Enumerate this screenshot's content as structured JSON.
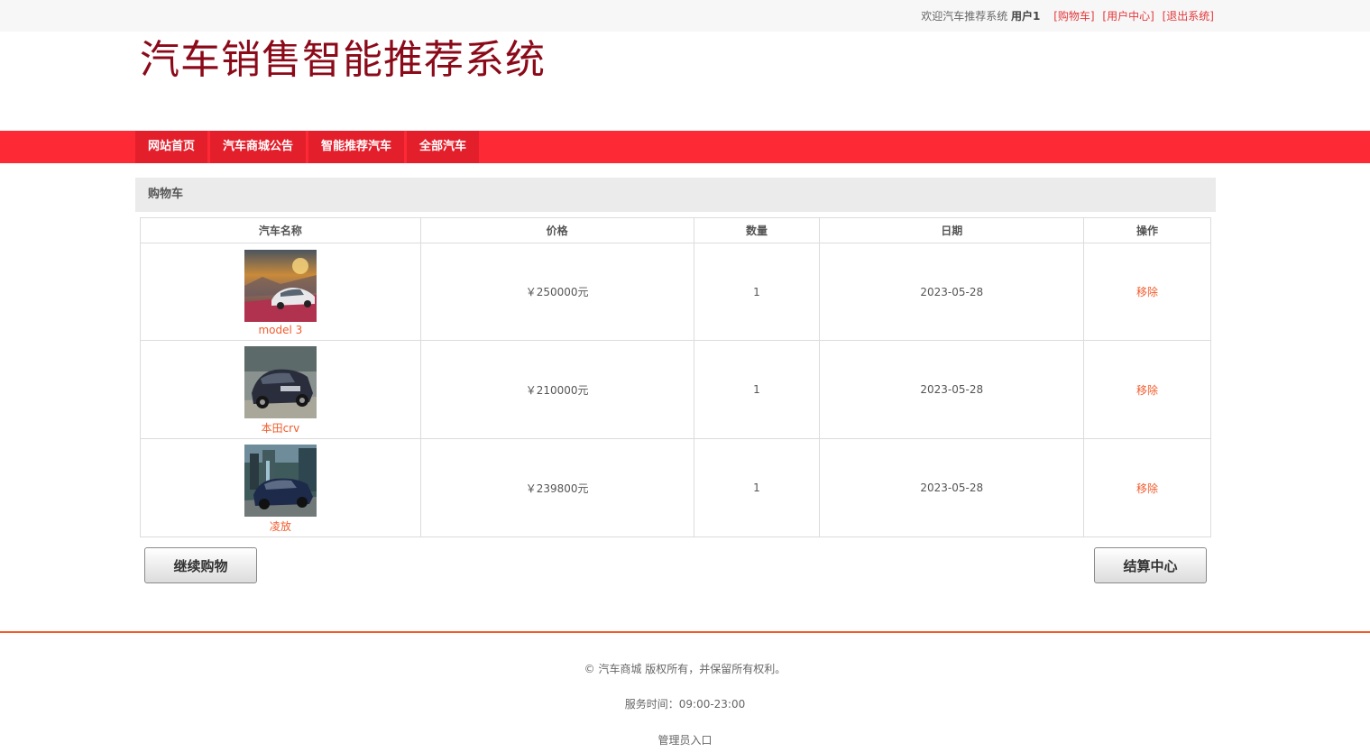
{
  "topbar": {
    "welcome": "欢迎汽车推荐系统",
    "username": "用户1",
    "cart_link": "[购物车]",
    "user_center_link": "[用户中心]",
    "logout_link": "[退出系统]"
  },
  "site_title": "汽车销售智能推荐系统",
  "nav": {
    "items": [
      {
        "label": "网站首页"
      },
      {
        "label": "汽车商城公告"
      },
      {
        "label": "智能推荐汽车"
      },
      {
        "label": "全部汽车"
      }
    ]
  },
  "cart": {
    "title": "购物车",
    "columns": [
      "汽车名称",
      "价格",
      "数量",
      "日期",
      "操作"
    ],
    "rows": [
      {
        "name": "model 3",
        "price": "￥250000元",
        "qty": "1",
        "date": "2023-05-28",
        "action": "移除"
      },
      {
        "name": "本田crv",
        "price": "￥210000元",
        "qty": "1",
        "date": "2023-05-28",
        "action": "移除"
      },
      {
        "name": "凌放",
        "price": "￥239800元",
        "qty": "1",
        "date": "2023-05-28",
        "action": "移除"
      }
    ],
    "continue_label": "继续购物",
    "checkout_label": "结算中心"
  },
  "footer": {
    "copyright": "© 汽车商城 版权所有，并保留所有权利。",
    "hours": "服务时间：09:00-23:00",
    "admin_link": "管理员入口"
  },
  "colors": {
    "nav_bg": "#fd2a35",
    "nav_item_bg": "#e41f2c",
    "title": "#8b0a19",
    "link": "#f25b2c"
  }
}
